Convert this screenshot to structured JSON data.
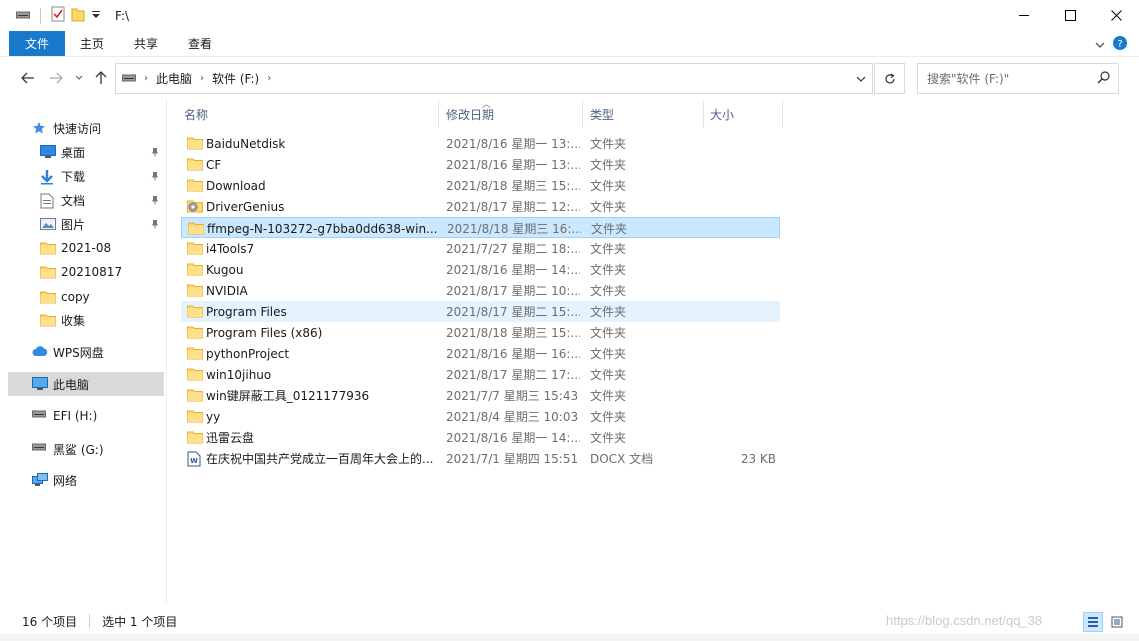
{
  "window": {
    "title": "F:\\",
    "minimize_icon": "minimize-icon",
    "maximize_icon": "maximize-icon",
    "close_icon": "close-icon"
  },
  "ribbon": {
    "tabs": [
      {
        "label": "文件",
        "active": true
      },
      {
        "label": "主页"
      },
      {
        "label": "共享"
      },
      {
        "label": "查看"
      }
    ],
    "accent": "#1979ca"
  },
  "address": {
    "crumbs": [
      "此电脑",
      "软件 (F:)"
    ],
    "search_placeholder": "搜索\"软件 (F:)\""
  },
  "nav": {
    "items": [
      {
        "label": "快速访问",
        "icon": "star-icon"
      },
      {
        "label": "桌面",
        "icon": "desktop-icon",
        "pinned": true
      },
      {
        "label": "下载",
        "icon": "download-icon",
        "pinned": true
      },
      {
        "label": "文档",
        "icon": "document-icon",
        "pinned": true
      },
      {
        "label": "图片",
        "icon": "picture-icon",
        "pinned": true
      },
      {
        "label": "2021-08",
        "icon": "folder-icon"
      },
      {
        "label": "20210817",
        "icon": "folder-icon"
      },
      {
        "label": "copy",
        "icon": "folder-icon"
      },
      {
        "label": "收集",
        "icon": "folder-icon"
      },
      {
        "label": "WPS网盘",
        "icon": "cloud-icon"
      },
      {
        "label": "此电脑",
        "icon": "computer-icon",
        "selected": true
      },
      {
        "label": "EFI (H:)",
        "icon": "drive-icon"
      },
      {
        "label": "黑鲨 (G:)",
        "icon": "drive-icon"
      },
      {
        "label": "网络",
        "icon": "network-icon"
      }
    ]
  },
  "columns": {
    "name": "名称",
    "date": "修改日期",
    "type": "类型",
    "size": "大小"
  },
  "files": [
    {
      "name": "BaiduNetdisk",
      "date": "2021/8/16 星期一 13:...",
      "type": "文件夹",
      "size": "",
      "icon": "folder-icon"
    },
    {
      "name": "CF",
      "date": "2021/8/16 星期一 13:...",
      "type": "文件夹",
      "size": "",
      "icon": "folder-icon"
    },
    {
      "name": "Download",
      "date": "2021/8/18 星期三 15:...",
      "type": "文件夹",
      "size": "",
      "icon": "folder-icon"
    },
    {
      "name": "DriverGenius",
      "date": "2021/8/17 星期二 12:...",
      "type": "文件夹",
      "size": "",
      "icon": "special-folder-icon"
    },
    {
      "name": "ffmpeg-N-103272-g7bba0dd638-win...",
      "date": "2021/8/18 星期三 16:...",
      "type": "文件夹",
      "size": "",
      "icon": "folder-icon",
      "selected": true
    },
    {
      "name": "i4Tools7",
      "date": "2021/7/27 星期二 18:...",
      "type": "文件夹",
      "size": "",
      "icon": "folder-icon"
    },
    {
      "name": "Kugou",
      "date": "2021/8/16 星期一 14:...",
      "type": "文件夹",
      "size": "",
      "icon": "folder-icon"
    },
    {
      "name": "NVIDIA",
      "date": "2021/8/17 星期二 10:...",
      "type": "文件夹",
      "size": "",
      "icon": "folder-icon"
    },
    {
      "name": "Program Files",
      "date": "2021/8/17 星期二 15:...",
      "type": "文件夹",
      "size": "",
      "icon": "folder-icon",
      "hover": true
    },
    {
      "name": "Program Files (x86)",
      "date": "2021/8/18 星期三 15:...",
      "type": "文件夹",
      "size": "",
      "icon": "folder-icon"
    },
    {
      "name": "pythonProject",
      "date": "2021/8/16 星期一 16:...",
      "type": "文件夹",
      "size": "",
      "icon": "folder-icon"
    },
    {
      "name": "win10jihuo",
      "date": "2021/8/17 星期二 17:...",
      "type": "文件夹",
      "size": "",
      "icon": "folder-icon"
    },
    {
      "name": "win键屏蔽工具_0121177936",
      "date": "2021/7/7 星期三 15:43",
      "type": "文件夹",
      "size": "",
      "icon": "folder-icon"
    },
    {
      "name": "yy",
      "date": "2021/8/4 星期三 10:03",
      "type": "文件夹",
      "size": "",
      "icon": "folder-icon"
    },
    {
      "name": "迅雷云盘",
      "date": "2021/8/16 星期一 14:...",
      "type": "文件夹",
      "size": "",
      "icon": "folder-icon"
    },
    {
      "name": "在庆祝中国共产党成立一百周年大会上的...",
      "date": "2021/7/1 星期四 15:51",
      "type": "DOCX 文档",
      "size": "23 KB",
      "icon": "word-doc-icon"
    }
  ],
  "status": {
    "count": "16 个项目",
    "selection": "选中 1 个项目"
  },
  "watermark": "https://blog.csdn.net/qq_38",
  "colors": {
    "selection": "#cce8ff",
    "selection_border": "#99d1ff",
    "folder": "#ffd766",
    "header_text": "#4d6082"
  }
}
